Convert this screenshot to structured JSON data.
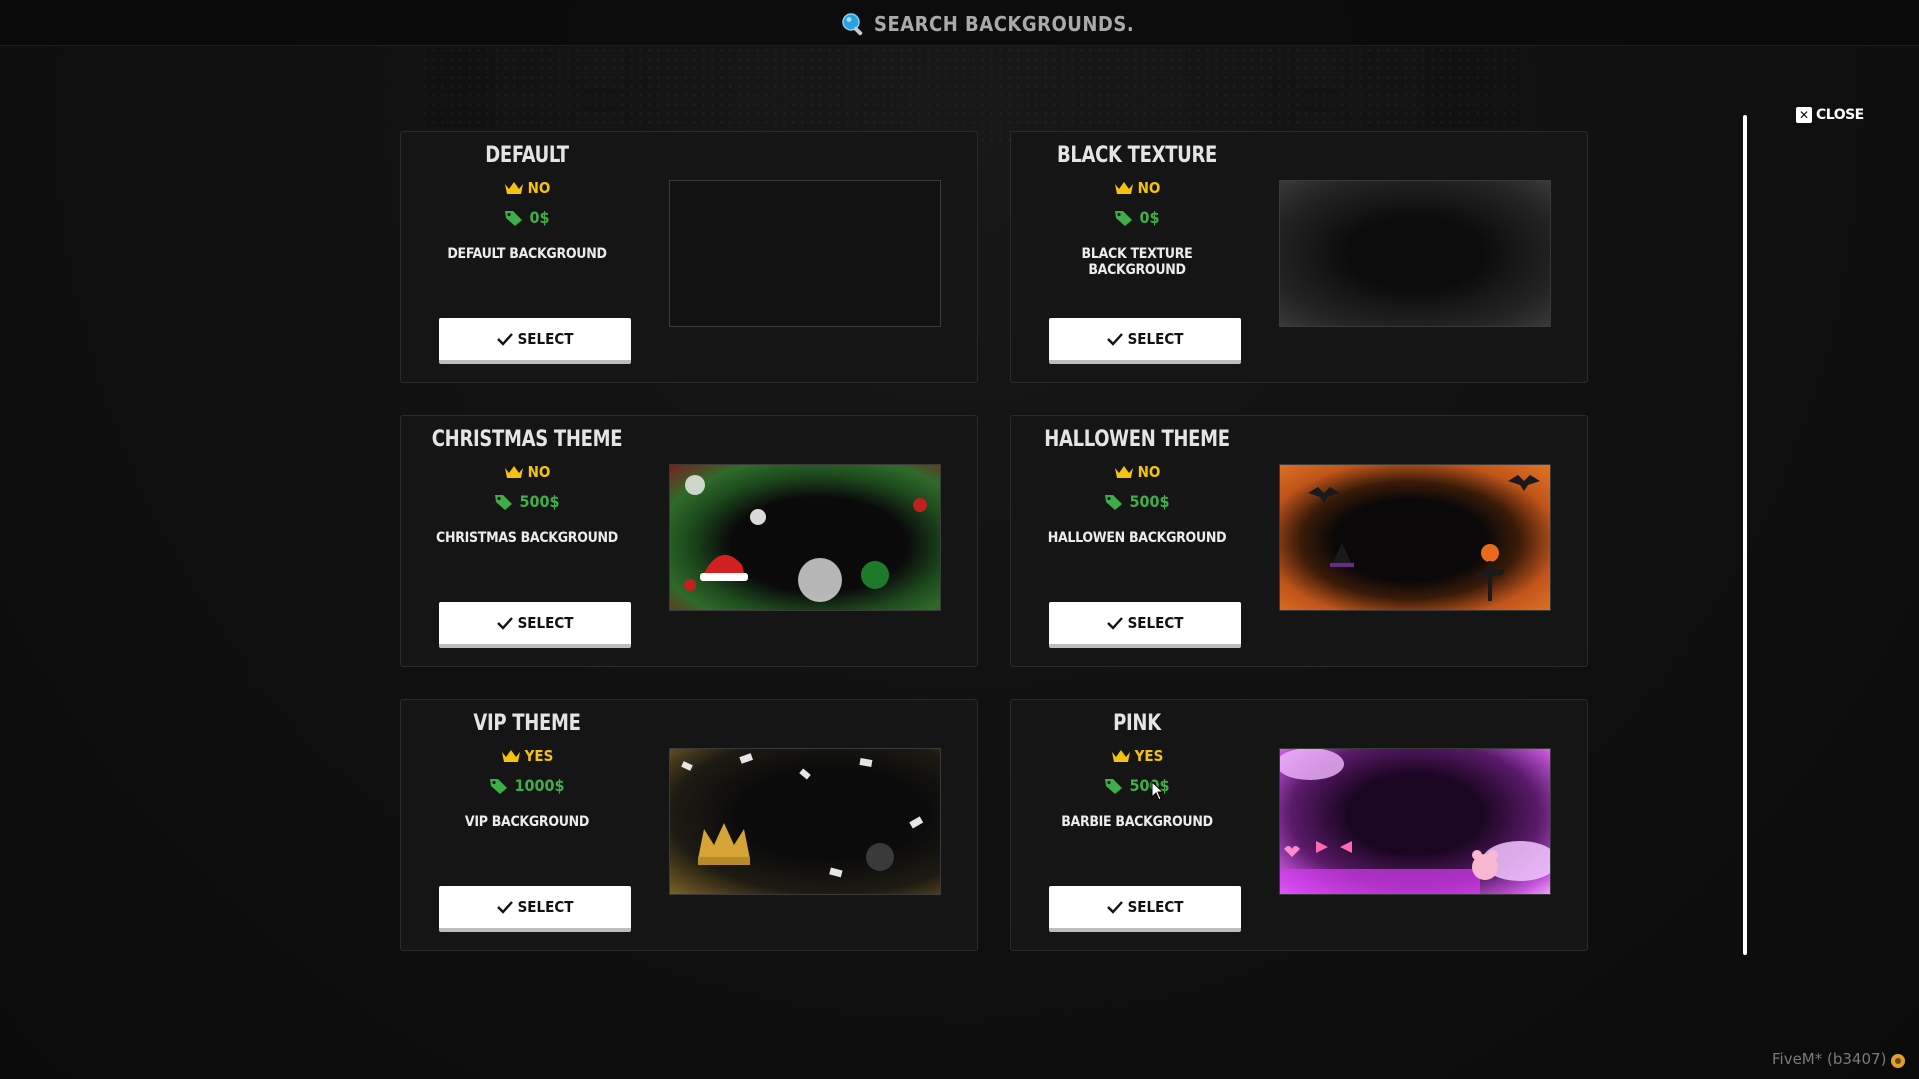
{
  "search": {
    "placeholder": "SEARCH BACKGROUNDS..."
  },
  "close": {
    "label": "CLOSE",
    "icon": "close-icon"
  },
  "colors": {
    "gold": "#f5c211",
    "green": "#3fae49",
    "card_bg": "#151515",
    "button_bg": "#ffffff"
  },
  "select_label": "SELECT",
  "backgrounds": [
    {
      "title": "DEFAULT",
      "vip": "NO",
      "price": "0$",
      "description": "DEFAULT BACKGROUND",
      "select_label": "SELECT"
    },
    {
      "title": "BLACK TEXTURE",
      "vip": "NO",
      "price": "0$",
      "description": "BLACK TEXTURE BACKGROUND",
      "select_label": "SELECT"
    },
    {
      "title": "CHRISTMAS THEME",
      "vip": "NO",
      "price": "500$",
      "description": "CHRISTMAS BACKGROUND",
      "select_label": "SELECT"
    },
    {
      "title": "HALLOWEN THEME",
      "vip": "NO",
      "price": "500$",
      "description": "HALLOWEN BACKGROUND",
      "select_label": "SELECT"
    },
    {
      "title": "VIP THEME",
      "vip": "YES",
      "price": "1000$",
      "description": "VIP BACKGROUND",
      "select_label": "SELECT"
    },
    {
      "title": "PINK",
      "vip": "YES",
      "price": "500$",
      "description": "BARBIE BACKGROUND",
      "select_label": "SELECT"
    }
  ],
  "footer": {
    "build": "FiveM* (b3407)"
  }
}
